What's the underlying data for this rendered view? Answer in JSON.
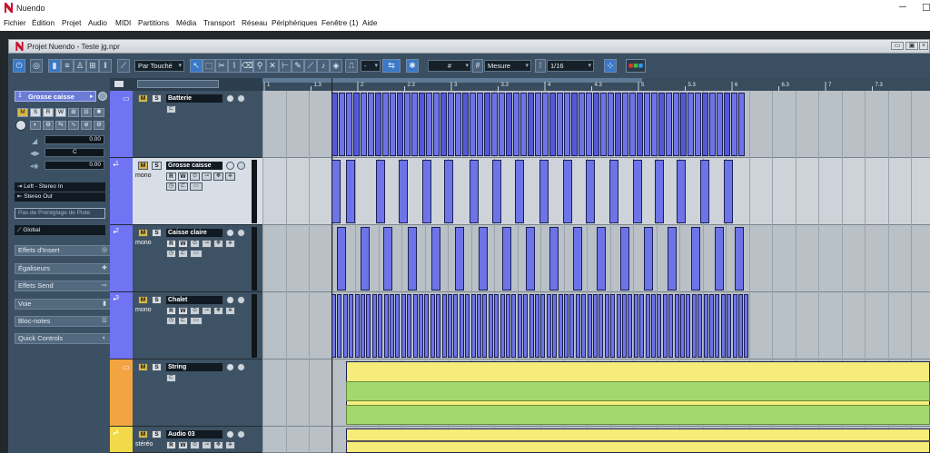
{
  "app": {
    "title": "Nuendo",
    "window_controls": [
      "─",
      "☐"
    ]
  },
  "menu": [
    "Fichier",
    "Édition",
    "Projet",
    "Audio",
    "MIDI",
    "Partitions",
    "Média",
    "Transport",
    "Réseau",
    "Périphériques",
    "Fenêtre (1)",
    "Aide"
  ],
  "project_window": {
    "title": "Projet Nuendo - Teste jg.npr"
  },
  "toolbar": {
    "automation_mode": "Par Touché",
    "snap_type": "Mesure",
    "quantize": "1/16",
    "grid_symbol": "#",
    "small_dd": "-"
  },
  "inspector": {
    "track_number": "1",
    "track_name": "Grosse caisse",
    "volume_value": "0.00",
    "pan_value": "C",
    "delay_value": "0.00",
    "input_routing": "Left - Stereo In",
    "output_routing": "Stereo Out",
    "preset_placeholder": "Pas de Préréglage de Piste",
    "global_label": "Global",
    "sections": [
      "Effets d'Insert",
      "Égaliseurs",
      "Effets Send",
      "Voie",
      "Bloc-notes",
      "Quick Controls"
    ]
  },
  "ruler": {
    "ticks": [
      "1",
      "1.3",
      "2",
      "2.3",
      "3",
      "3.3",
      "4",
      "4.3",
      "5",
      "5.3",
      "6",
      "6.3",
      "7",
      "7.3"
    ],
    "tick_positions_note": "bars"
  },
  "tracks": [
    {
      "type": "folder",
      "name": "Batterie",
      "number": "",
      "sub": "",
      "color": "#6f74f2"
    },
    {
      "type": "audio",
      "name": "Grosse caisse",
      "number": "1",
      "sub": "mono",
      "color": "#6f74f2"
    },
    {
      "type": "audio",
      "name": "Caisse claire",
      "number": "2",
      "sub": "mono",
      "color": "#6f74f2"
    },
    {
      "type": "audio",
      "name": "Chalet",
      "number": "3",
      "sub": "mono",
      "color": "#6f74f2"
    },
    {
      "type": "folder",
      "name": "String",
      "number": "",
      "sub": "",
      "color": "#f2a442"
    },
    {
      "type": "audio",
      "name": "Audio 03",
      "number": "4",
      "sub": "stéréo",
      "color": "#f2d94a"
    }
  ],
  "track_buttons": {
    "mute": "M",
    "solo": "S",
    "read": "R",
    "write": "W"
  },
  "colors": {
    "drum_events": "#6d74e8",
    "string_part": "#f5ec7a",
    "string_lane": "#9fd46a",
    "frame": "#23282c"
  }
}
